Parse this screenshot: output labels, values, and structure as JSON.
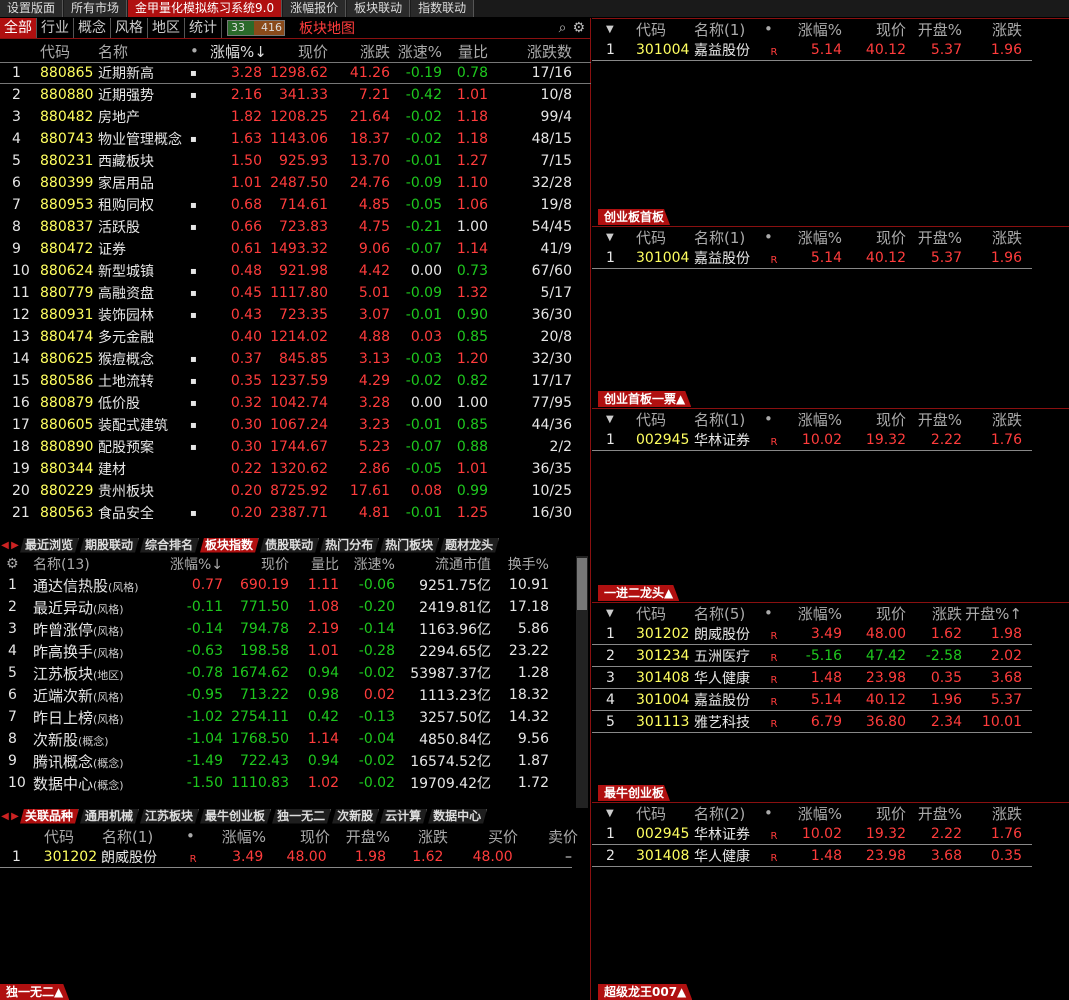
{
  "top_tabs": [
    "设置版面",
    "所有市场",
    "金甲量化模拟练习系统9.0",
    "涨幅报价",
    "板块联动",
    "指数联动"
  ],
  "cat_tabs": [
    "全部",
    "行业",
    "概念",
    "风格",
    "地区",
    "统计"
  ],
  "stat": {
    "up": "33",
    "down": "416"
  },
  "map_link": "板块地图",
  "sector_table": {
    "headers": [
      "代码",
      "名称",
      "•",
      "涨幅%↓",
      "现价",
      "涨跌",
      "涨速%",
      "量比",
      "涨跌数"
    ],
    "rows": [
      [
        "1",
        "880865",
        "近期新高",
        "▪",
        "3.28",
        "1298.62",
        "41.26",
        "-0.19",
        "0.78",
        "17/16"
      ],
      [
        "2",
        "880880",
        "近期强势",
        "▪",
        "2.16",
        "341.33",
        "7.21",
        "-0.42",
        "1.01",
        "10/8"
      ],
      [
        "3",
        "880482",
        "房地产",
        "",
        "1.82",
        "1208.25",
        "21.64",
        "-0.02",
        "1.18",
        "99/4"
      ],
      [
        "4",
        "880743",
        "物业管理概念",
        "▪",
        "1.63",
        "1143.06",
        "18.37",
        "-0.02",
        "1.18",
        "48/15"
      ],
      [
        "5",
        "880231",
        "西藏板块",
        "",
        "1.50",
        "925.93",
        "13.70",
        "-0.01",
        "1.27",
        "7/15"
      ],
      [
        "6",
        "880399",
        "家居用品",
        "",
        "1.01",
        "2487.50",
        "24.76",
        "-0.09",
        "1.10",
        "32/28"
      ],
      [
        "7",
        "880953",
        "租购同权",
        "▪",
        "0.68",
        "714.61",
        "4.85",
        "-0.05",
        "1.06",
        "19/8"
      ],
      [
        "8",
        "880837",
        "活跃股",
        "▪",
        "0.66",
        "723.83",
        "4.75",
        "-0.21",
        "1.00",
        "54/45"
      ],
      [
        "9",
        "880472",
        "证券",
        "",
        "0.61",
        "1493.32",
        "9.06",
        "-0.07",
        "1.14",
        "41/9"
      ],
      [
        "10",
        "880624",
        "新型城镇",
        "▪",
        "0.48",
        "921.98",
        "4.42",
        "0.00",
        "0.73",
        "67/60"
      ],
      [
        "11",
        "880779",
        "高融资盘",
        "▪",
        "0.45",
        "1117.80",
        "5.01",
        "-0.09",
        "1.32",
        "5/17"
      ],
      [
        "12",
        "880931",
        "装饰园林",
        "▪",
        "0.43",
        "723.35",
        "3.07",
        "-0.01",
        "0.90",
        "36/30"
      ],
      [
        "13",
        "880474",
        "多元金融",
        "",
        "0.40",
        "1214.02",
        "4.88",
        "0.03",
        "0.85",
        "20/8"
      ],
      [
        "14",
        "880625",
        "猴痘概念",
        "▪",
        "0.37",
        "845.85",
        "3.13",
        "-0.03",
        "1.20",
        "32/30"
      ],
      [
        "15",
        "880586",
        "土地流转",
        "▪",
        "0.35",
        "1237.59",
        "4.29",
        "-0.02",
        "0.82",
        "17/17"
      ],
      [
        "16",
        "880879",
        "低价股",
        "▪",
        "0.32",
        "1042.74",
        "3.28",
        "0.00",
        "1.00",
        "77/95"
      ],
      [
        "17",
        "880605",
        "装配式建筑",
        "▪",
        "0.30",
        "1067.24",
        "3.23",
        "-0.01",
        "0.85",
        "44/36"
      ],
      [
        "18",
        "880890",
        "配股预案",
        "▪",
        "0.30",
        "1744.67",
        "5.23",
        "-0.07",
        "0.88",
        "2/2"
      ],
      [
        "19",
        "880344",
        "建材",
        "",
        "0.22",
        "1320.62",
        "2.86",
        "-0.05",
        "1.01",
        "36/35"
      ],
      [
        "20",
        "880229",
        "贵州板块",
        "",
        "0.20",
        "8725.92",
        "17.61",
        "0.08",
        "0.99",
        "10/25"
      ],
      [
        "21",
        "880563",
        "食品安全",
        "▪",
        "0.20",
        "2387.71",
        "4.81",
        "-0.01",
        "1.25",
        "16/30"
      ]
    ]
  },
  "mid_tabs": [
    "最近浏览",
    "期股联动",
    "综合排名",
    "板块指数",
    "债股联动",
    "热门分布",
    "热门板块",
    "题材龙头"
  ],
  "index_table": {
    "headers": [
      "名称(13)",
      "涨幅%↓",
      "现价",
      "量比",
      "涨速%",
      "流通市值",
      "换手%"
    ],
    "rows": [
      [
        "1",
        "通达信热股",
        "(风格)",
        "0.77",
        "690.19",
        "1.11",
        "-0.06",
        "9251.75亿",
        "10.91"
      ],
      [
        "2",
        "最近异动",
        "(风格)",
        "-0.11",
        "771.50",
        "1.08",
        "-0.20",
        "2419.81亿",
        "17.18"
      ],
      [
        "3",
        "昨曾涨停",
        "(风格)",
        "-0.14",
        "794.78",
        "2.19",
        "-0.14",
        "1163.96亿",
        "5.86"
      ],
      [
        "4",
        "昨高换手",
        "(风格)",
        "-0.63",
        "198.58",
        "1.01",
        "-0.28",
        "2294.65亿",
        "23.22"
      ],
      [
        "5",
        "江苏板块",
        "(地区)",
        "-0.78",
        "1674.62",
        "0.94",
        "-0.02",
        "53987.37亿",
        "1.28"
      ],
      [
        "6",
        "近端次新",
        "(风格)",
        "-0.95",
        "713.22",
        "0.98",
        "0.02",
        "1113.23亿",
        "18.32"
      ],
      [
        "7",
        "昨日上榜",
        "(风格)",
        "-1.02",
        "2754.11",
        "0.42",
        "-0.13",
        "3257.50亿",
        "14.32"
      ],
      [
        "8",
        "次新股",
        "(概念)",
        "-1.04",
        "1768.50",
        "1.14",
        "-0.04",
        "4850.84亿",
        "9.56"
      ],
      [
        "9",
        "腾讯概念",
        "(概念)",
        "-1.49",
        "722.43",
        "0.94",
        "-0.02",
        "16574.52亿",
        "1.87"
      ],
      [
        "10",
        "数据中心",
        "(概念)",
        "-1.50",
        "1110.83",
        "1.02",
        "-0.02",
        "19709.42亿",
        "1.72"
      ]
    ]
  },
  "bottom_tabs": [
    "关联品种",
    "通用机械",
    "江苏板块",
    "最牛创业板",
    "独一无二",
    "次新股",
    "云计算",
    "数据中心"
  ],
  "related_table": {
    "headers": [
      "代码",
      "名称(1)",
      "•",
      "涨幅%",
      "现价",
      "开盘%",
      "涨跌",
      "买价",
      "卖价"
    ],
    "rows": [
      [
        "1",
        "301202",
        "朗威股份",
        "R",
        "3.49",
        "48.00",
        "1.98",
        "1.62",
        "48.00",
        "–"
      ]
    ]
  },
  "bottom_left_label": "独一无二▲",
  "right_panels": [
    {
      "label": "",
      "headers": [
        "代码",
        "名称(1)",
        "•",
        "涨幅%",
        "现价",
        "开盘%",
        "涨跌"
      ],
      "rows": [
        [
          "1",
          "301004",
          "嘉益股份",
          "R",
          "5.14",
          "40.12",
          "5.37",
          "1.96"
        ]
      ]
    },
    {
      "label": "创业板首板",
      "headers": [
        "代码",
        "名称(1)",
        "•",
        "涨幅%",
        "现价",
        "开盘%",
        "涨跌"
      ],
      "rows": [
        [
          "1",
          "301004",
          "嘉益股份",
          "R",
          "5.14",
          "40.12",
          "5.37",
          "1.96"
        ]
      ]
    },
    {
      "label": "创业首板一票▲",
      "headers": [
        "代码",
        "名称(1)",
        "•",
        "涨幅%",
        "现价",
        "开盘%",
        "涨跌"
      ],
      "rows": [
        [
          "1",
          "002945",
          "华林证券",
          "R",
          "10.02",
          "19.32",
          "2.22",
          "1.76"
        ]
      ]
    },
    {
      "label": "一进二龙头▲",
      "headers": [
        "代码",
        "名称(5)",
        "•",
        "涨幅%",
        "现价",
        "涨跌",
        "开盘%↑"
      ],
      "rows": [
        [
          "1",
          "301202",
          "朗威股份",
          "R",
          "3.49",
          "48.00",
          "1.62",
          "1.98"
        ],
        [
          "2",
          "301234",
          "五洲医疗",
          "R",
          "-5.16",
          "47.42",
          "-2.58",
          "2.02"
        ],
        [
          "3",
          "301408",
          "华人健康",
          "R",
          "1.48",
          "23.98",
          "0.35",
          "3.68"
        ],
        [
          "4",
          "301004",
          "嘉益股份",
          "R",
          "5.14",
          "40.12",
          "1.96",
          "5.37"
        ],
        [
          "5",
          "301113",
          "雅艺科技",
          "R",
          "6.79",
          "36.80",
          "2.34",
          "10.01"
        ]
      ]
    },
    {
      "label": "最牛创业板",
      "headers": [
        "代码",
        "名称(2)",
        "•",
        "涨幅%",
        "现价",
        "开盘%",
        "涨跌"
      ],
      "rows": [
        [
          "1",
          "002945",
          "华林证券",
          "R",
          "10.02",
          "19.32",
          "2.22",
          "1.76"
        ],
        [
          "2",
          "301408",
          "华人健康",
          "R",
          "1.48",
          "23.98",
          "3.68",
          "0.35"
        ]
      ]
    }
  ],
  "bottom_right_label": "超级龙王007▲"
}
